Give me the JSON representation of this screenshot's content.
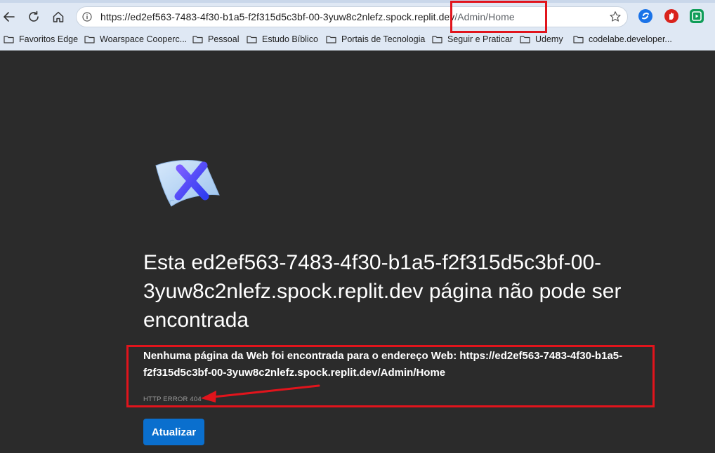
{
  "browser": {
    "url_host": "https://ed2ef563-7483-4f30-b1a5-f2f315d5c3bf-00-3yuw8c2nlefz.spock.replit.dev",
    "url_path": "/Admin/Home",
    "icons": [
      "back-icon",
      "refresh-icon",
      "home-icon",
      "info-icon",
      "star-icon",
      "extension-blue-icon",
      "extension-red-icon",
      "extension-green-icon"
    ]
  },
  "bookmarks": [
    {
      "label": "Favoritos Edge"
    },
    {
      "label": "Woarspace Cooperc..."
    },
    {
      "label": "Pessoal"
    },
    {
      "label": "Estudo Bíblico"
    },
    {
      "label": "Portais de Tecnologia"
    },
    {
      "label": "Seguir e Praticar"
    },
    {
      "label": "Udemy"
    },
    {
      "label": "codelabe.developer..."
    }
  ],
  "error_page": {
    "title": "Esta ed2ef563-7483-4f30-b1a5-f2f315d5c3bf-00-3yuw8c2nlefz.spock.replit.dev página não pode ser encontrada",
    "description_lead": "Nenhuma página da Web foi encontrada para o endereço Web: ",
    "description_url": "https://ed2ef563-7483-4f30-b1a5-f2f315d5c3bf-00-3yuw8c2nlefz.spock.replit.dev/Admin/Home",
    "error_code": "HTTP ERROR 404",
    "refresh_label": "Atualizar"
  },
  "colors": {
    "page_bg": "#2b2b2b",
    "browser_chrome": "#dfe8f4",
    "button_blue": "#0a6fce",
    "annotation_red": "#e1141c"
  }
}
